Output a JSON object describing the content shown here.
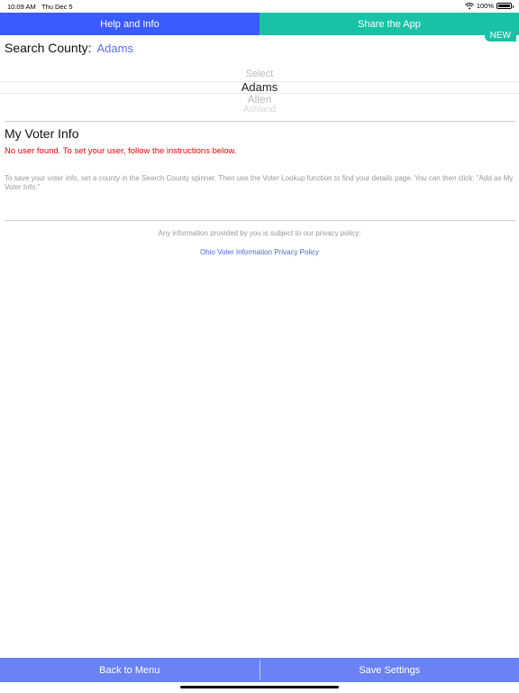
{
  "status_bar": {
    "time": "10:09 AM",
    "date": "Thu Dec 5",
    "battery": "100%"
  },
  "tabs": {
    "help": "Help and Info",
    "share": "Share the App",
    "new_badge": "NEW"
  },
  "search": {
    "label": "Search County:",
    "value": "Adams"
  },
  "picker": {
    "items": [
      "Select",
      "Adams",
      "Allen",
      "Ashland"
    ]
  },
  "voter": {
    "title": "My Voter Info",
    "error": "No user found. To set your user, follow the instructions below.",
    "instructions": "To save your voter info, set a county in the Search County spinner. Then use the Voter Lookup function to find your details page. You can then click: \"Add as My Voter Info.\""
  },
  "privacy": {
    "note": "Any information provided by you is subject to our privacy policy:",
    "link": "Ohio Voter Information Privacy Policy"
  },
  "bottom": {
    "back": "Back to Menu",
    "save": "Save Settings"
  },
  "colors": {
    "help_tab": "#3a5cff",
    "share_tab": "#19c2a5",
    "bottom_bar": "#6a82f3",
    "error": "#e00000",
    "link": "#4e66d8"
  }
}
